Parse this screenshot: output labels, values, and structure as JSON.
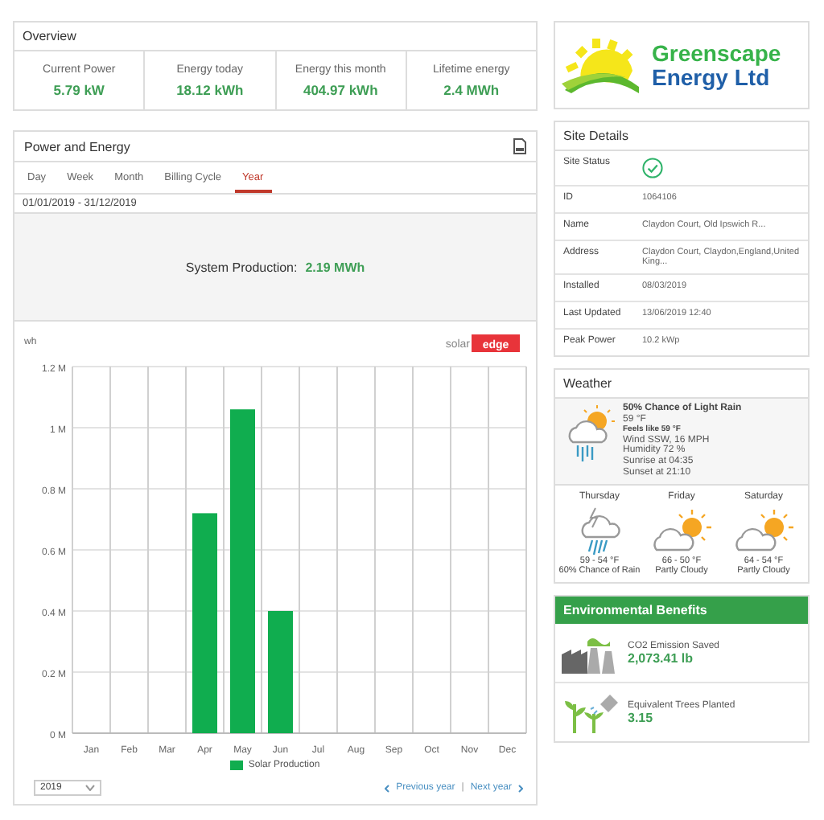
{
  "overview": {
    "title": "Overview",
    "stats": [
      {
        "label": "Current Power",
        "value": "5.79 kW"
      },
      {
        "label": "Energy today",
        "value": "18.12 kWh"
      },
      {
        "label": "Energy this month",
        "value": "404.97 kWh"
      },
      {
        "label": "Lifetime energy",
        "value": "2.4 MWh"
      }
    ]
  },
  "power_energy": {
    "title": "Power and Energy",
    "tabs": [
      {
        "label": "Day",
        "selected": false
      },
      {
        "label": "Week",
        "selected": false
      },
      {
        "label": "Month",
        "selected": false
      },
      {
        "label": "Billing Cycle",
        "selected": false
      },
      {
        "label": "Year",
        "selected": true
      }
    ],
    "date_range": "01/01/2019 - 31/12/2019",
    "production_label": "System Production:",
    "production_value": "2.19 MWh",
    "brand": {
      "first": "solar",
      "second": "edge"
    },
    "chart_data": {
      "type": "bar",
      "ylabel": "wh",
      "categories": [
        "Jan",
        "Feb",
        "Mar",
        "Apr",
        "May",
        "Jun",
        "Jul",
        "Aug",
        "Sep",
        "Oct",
        "Nov",
        "Dec"
      ],
      "series": [
        {
          "name": "Solar Production",
          "color": "#10ad4f",
          "values": [
            0,
            0,
            0,
            720000,
            1060000,
            400000,
            0,
            0,
            0,
            0,
            0,
            0
          ]
        }
      ],
      "ylim": [
        0,
        1200000
      ],
      "grid": true,
      "yticks": [
        {
          "value": 0,
          "label": "0 M"
        },
        {
          "value": 200000,
          "label": "0.2 M"
        },
        {
          "value": 400000,
          "label": "0.4 M"
        },
        {
          "value": 600000,
          "label": "0.6 M"
        },
        {
          "value": 800000,
          "label": "0.8 M"
        },
        {
          "value": 1000000,
          "label": "1 M"
        },
        {
          "value": 1200000,
          "label": "1.2 M"
        }
      ]
    },
    "year_select": "2019",
    "prev_link": "Previous year",
    "separator": "|",
    "next_link": "Next year"
  },
  "logo": {
    "line1": "Greenscape",
    "line2": "Energy Ltd"
  },
  "site_details": {
    "title": "Site Details",
    "status_label": "Site Status",
    "rows": [
      {
        "label": "ID",
        "value": "1064106"
      },
      {
        "label": "Name",
        "value": "Claydon Court, Old Ipswich R..."
      },
      {
        "label": "Address",
        "value": "Claydon Court, Claydon,England,United King..."
      },
      {
        "label": "Installed",
        "value": "08/03/2019"
      },
      {
        "label": "Last Updated",
        "value": "13/06/2019 12:40"
      },
      {
        "label": "Peak Power",
        "value": "10.2 kWp"
      }
    ]
  },
  "weather": {
    "title": "Weather",
    "now": {
      "kind": "light-rain",
      "summary": "50% Chance of Light Rain",
      "temp": "59 °F",
      "feels": "Feels like 59 °F",
      "wind": "Wind SSW, 16 MPH",
      "humidity": "Humidity 72 %",
      "sunrise": "Sunrise at 04:35",
      "sunset": "Sunset at 21:10"
    },
    "forecast": [
      {
        "day": "Thursday",
        "kind": "thunder-rain",
        "temp": "59 - 54 °F",
        "desc": "60% Chance of Rain"
      },
      {
        "day": "Friday",
        "kind": "partly-cloudy",
        "temp": "66 - 50 °F",
        "desc": "Partly Cloudy"
      },
      {
        "day": "Saturday",
        "kind": "partly-cloudy",
        "temp": "64 - 54 °F",
        "desc": "Partly Cloudy"
      }
    ]
  },
  "environment": {
    "title": "Environmental Benefits",
    "items": [
      {
        "kind": "co2",
        "label": "CO2 Emission Saved",
        "value": "2,073.41 lb"
      },
      {
        "kind": "trees",
        "label": "Equivalent Trees Planted",
        "value": "3.15"
      }
    ]
  }
}
